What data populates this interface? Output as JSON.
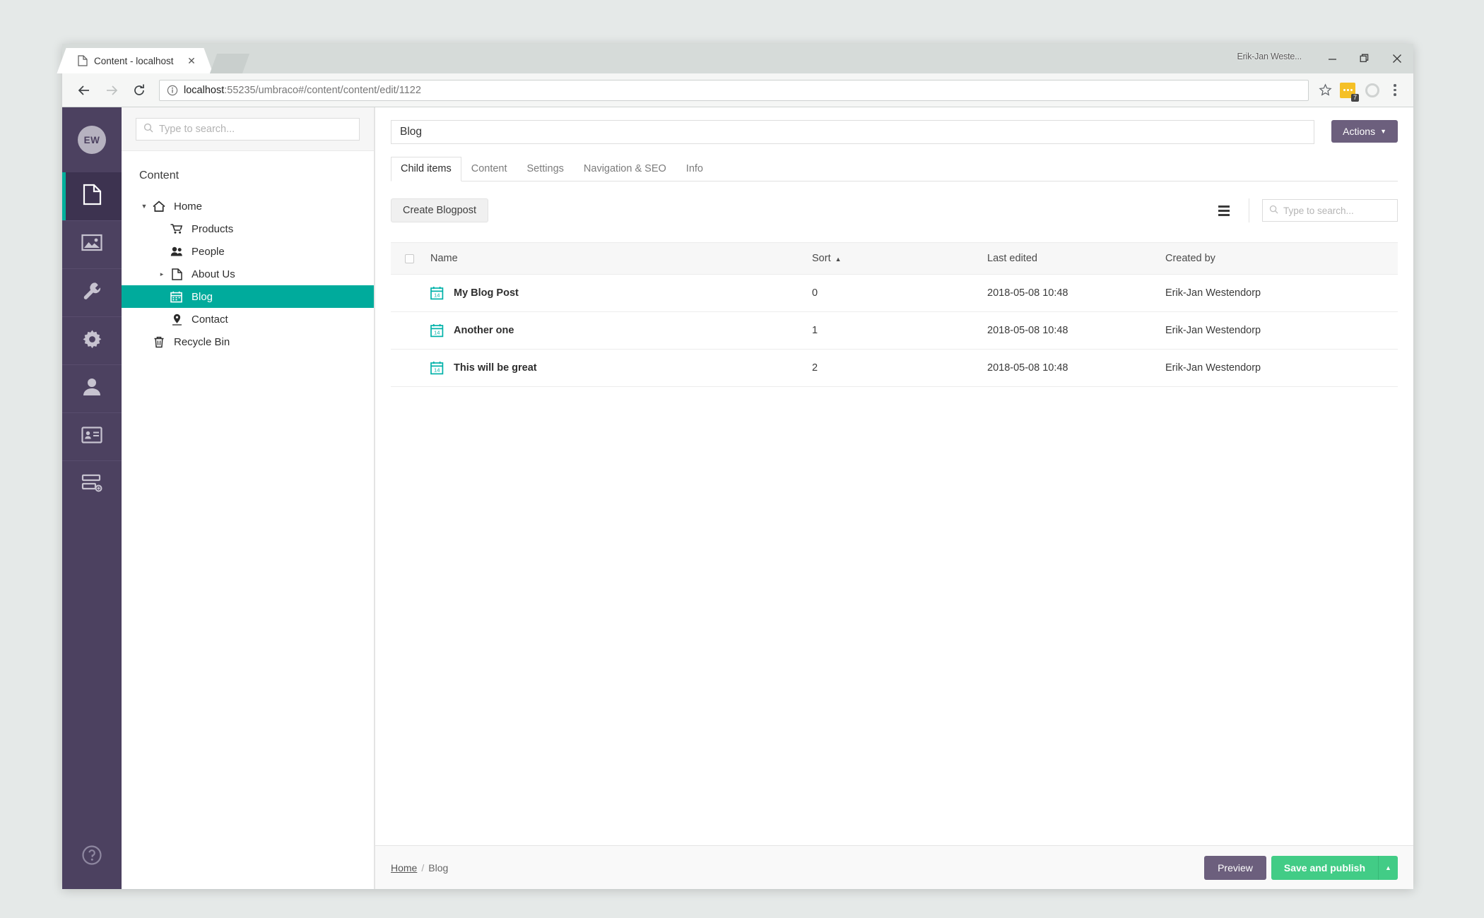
{
  "browser": {
    "tab": {
      "title": "Content - localhost",
      "favicon": "page-icon",
      "close": "✕"
    },
    "profile_label": "Erik-Jan Weste...",
    "window_controls": {
      "minimize": "minimize-icon",
      "maximize": "maximize-icon",
      "close": "close-icon"
    },
    "nav": {
      "back": "back-arrow-icon",
      "forward": "forward-arrow-icon",
      "reload": "reload-icon"
    },
    "address": {
      "info_icon": "info-circle-icon",
      "host": "localhost",
      "rest": ":55235/umbraco#/content/content/edit/1122"
    },
    "extensions": {
      "badge_count": "7"
    }
  },
  "rail": {
    "avatar_initials": "EW",
    "items": [
      {
        "name": "content",
        "icon": "document-icon",
        "active": true
      },
      {
        "name": "media",
        "icon": "image-icon",
        "active": false
      },
      {
        "name": "settings",
        "icon": "wrench-icon",
        "active": false
      },
      {
        "name": "developer",
        "icon": "gear-icon",
        "active": false
      },
      {
        "name": "users",
        "icon": "user-icon",
        "active": false
      },
      {
        "name": "members",
        "icon": "id-card-icon",
        "active": false
      },
      {
        "name": "forms",
        "icon": "forms-icon",
        "active": false
      }
    ],
    "help_icon": "help-circle-icon"
  },
  "tree_panel": {
    "search_placeholder": "Type to search...",
    "heading": "Content",
    "nodes": [
      {
        "label": "Home",
        "icon": "home-icon",
        "level": 1,
        "caret": "expanded",
        "selected": false
      },
      {
        "label": "Products",
        "icon": "cart-icon",
        "level": 2,
        "caret": "none",
        "selected": false
      },
      {
        "label": "People",
        "icon": "people-icon",
        "level": 2,
        "caret": "none",
        "selected": false
      },
      {
        "label": "About Us",
        "icon": "document-icon",
        "level": 2,
        "caret": "collapsed",
        "selected": false
      },
      {
        "label": "Blog",
        "icon": "calendar-icon",
        "level": 2,
        "caret": "none",
        "selected": true
      },
      {
        "label": "Contact",
        "icon": "map-pin-icon",
        "level": 2,
        "caret": "none",
        "selected": false
      },
      {
        "label": "Recycle Bin",
        "icon": "trash-icon",
        "level": 1,
        "caret": "none",
        "selected": false
      }
    ]
  },
  "editor": {
    "title_value": "Blog",
    "actions_label": "Actions",
    "tabs": [
      {
        "label": "Child items",
        "active": true
      },
      {
        "label": "Content",
        "active": false
      },
      {
        "label": "Settings",
        "active": false
      },
      {
        "label": "Navigation & SEO",
        "active": false
      },
      {
        "label": "Info",
        "active": false
      }
    ],
    "toolbar": {
      "create_label": "Create Blogpost",
      "layout_icon": "list-view-icon",
      "search_placeholder": "Type to search..."
    },
    "listview": {
      "columns": [
        {
          "key": "name",
          "label": "Name",
          "sorted": false
        },
        {
          "key": "sort",
          "label": "Sort",
          "sorted": true,
          "direction": "▲"
        },
        {
          "key": "edited",
          "label": "Last edited",
          "sorted": false
        },
        {
          "key": "creator",
          "label": "Created by",
          "sorted": false
        }
      ],
      "rows": [
        {
          "icon": "calendar-icon",
          "name": "My Blog Post",
          "sort": "0",
          "edited": "2018-05-08 10:48",
          "creator": "Erik-Jan Westendorp"
        },
        {
          "icon": "calendar-icon",
          "name": "Another one",
          "sort": "1",
          "edited": "2018-05-08 10:48",
          "creator": "Erik-Jan Westendorp"
        },
        {
          "icon": "calendar-icon",
          "name": "This will be great",
          "sort": "2",
          "edited": "2018-05-08 10:48",
          "creator": "Erik-Jan Westendorp"
        }
      ]
    },
    "footer": {
      "breadcrumb_root": "Home",
      "breadcrumb_sep": "/",
      "breadcrumb_current": "Blog",
      "preview_label": "Preview",
      "publish_label": "Save and publish",
      "publish_caret": "▲"
    }
  },
  "colors": {
    "teal": "#00ab9c",
    "purple": "#4c4160",
    "purple_button": "#6c5f7d",
    "green": "#42cc86",
    "desktop": "#e5e9e8"
  }
}
